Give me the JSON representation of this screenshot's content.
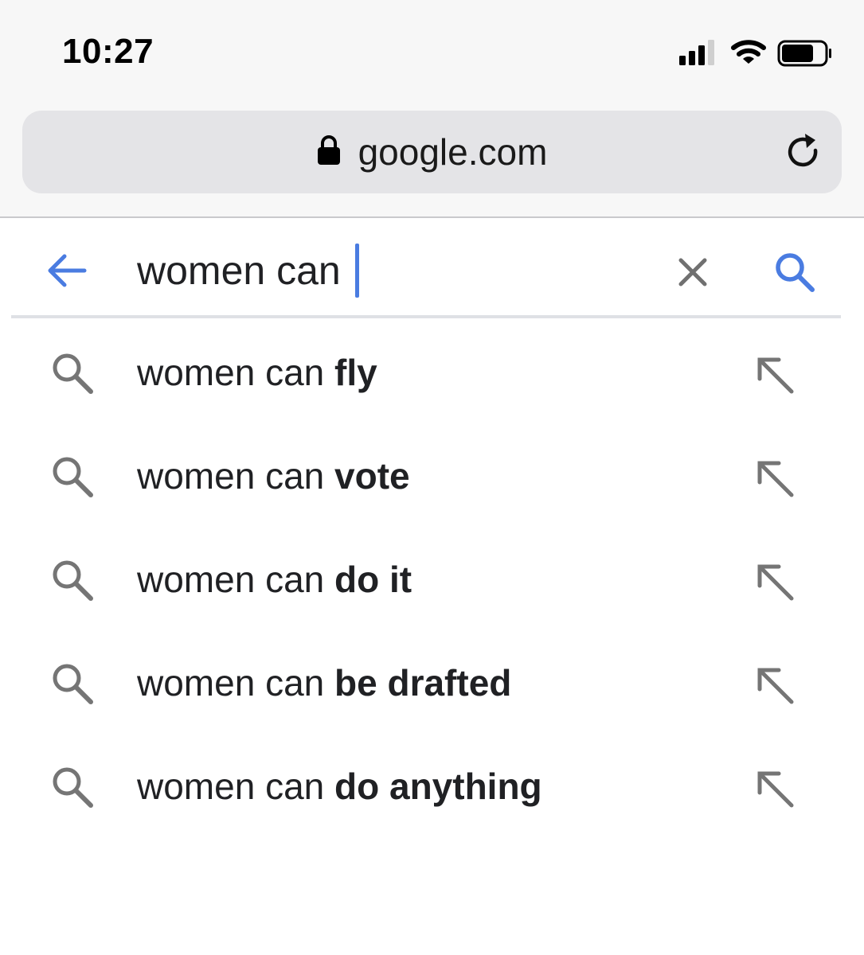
{
  "status_bar": {
    "time": "10:27",
    "icons": [
      "signal-icon",
      "wifi-icon",
      "battery-icon"
    ],
    "battery_level": 0.75
  },
  "browser": {
    "lock_icon": "lock-icon",
    "url": "google.com",
    "reload_icon": "reload-icon"
  },
  "search": {
    "back_icon": "back-arrow-icon",
    "query": "women can ",
    "clear_icon": "close-icon",
    "search_icon": "search-icon",
    "accent_color": "#4a7ce1"
  },
  "suggestions": [
    {
      "prefix": "women can ",
      "completion": "fly"
    },
    {
      "prefix": "women can ",
      "completion": "vote"
    },
    {
      "prefix": "women can ",
      "completion": "do it"
    },
    {
      "prefix": "women can ",
      "completion": "be drafted"
    },
    {
      "prefix": "women can ",
      "completion": "do anything"
    }
  ],
  "suggestion_icons": {
    "leading": "search-icon",
    "trailing": "fill-query-arrow-icon"
  }
}
